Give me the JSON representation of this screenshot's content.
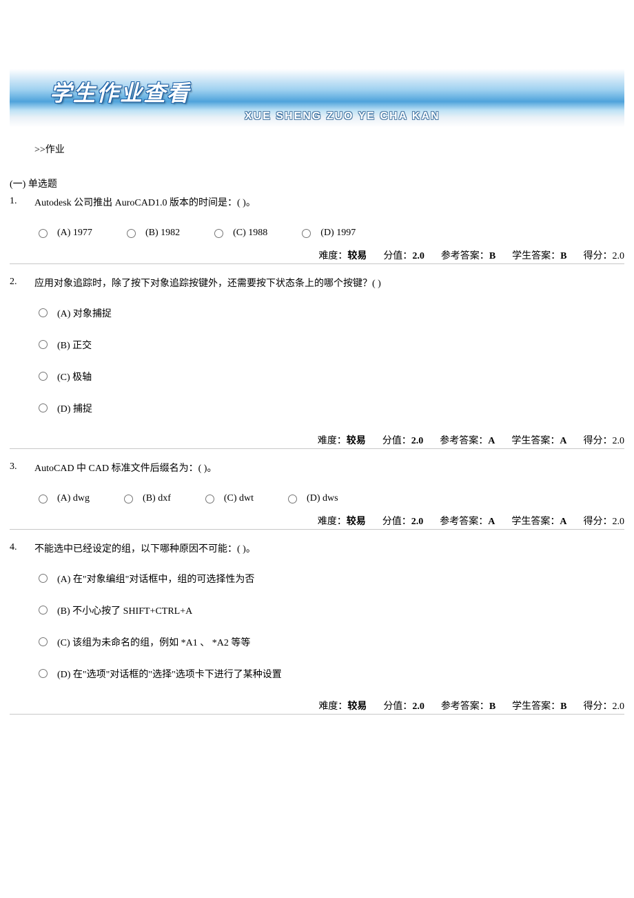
{
  "banner": {
    "title_cn": "学生作业查看",
    "title_en": "XUE SHENG ZUO YE CHA KAN"
  },
  "breadcrumb": ">>作业",
  "section_label": "(一) 单选题",
  "labels": {
    "difficulty": "难度：",
    "score_value": "分值：",
    "ref_answer": "参考答案：",
    "student_answer": "学生答案：",
    "got_score": "得分："
  },
  "questions": [
    {
      "num": "1.",
      "text": "Autodesk 公司推出 AuroCAD1.0 版本的时间是：( )。",
      "layout": "inline",
      "options": [
        {
          "label": "(A) 1977"
        },
        {
          "label": "(B) 1982"
        },
        {
          "label": "(C) 1988"
        },
        {
          "label": "(D) 1997"
        }
      ],
      "meta": {
        "difficulty": "较易",
        "score_value": "2.0",
        "ref_answer": "B",
        "student_answer": "B",
        "got_score": "2.0"
      }
    },
    {
      "num": "2.",
      "text": "应用对象追踪时，除了按下对象追踪按键外，还需要按下状态条上的哪个按键？( )",
      "layout": "stack",
      "options": [
        {
          "label": "(A) 对象捕捉"
        },
        {
          "label": "(B) 正交"
        },
        {
          "label": "(C) 极轴"
        },
        {
          "label": "(D) 捕捉"
        }
      ],
      "meta": {
        "difficulty": "较易",
        "score_value": "2.0",
        "ref_answer": "A",
        "student_answer": "A",
        "got_score": "2.0"
      }
    },
    {
      "num": "3.",
      "text": "AutoCAD 中 CAD 标准文件后缀名为：( )。",
      "layout": "inline",
      "options": [
        {
          "label": "(A) dwg"
        },
        {
          "label": "(B) dxf"
        },
        {
          "label": "(C) dwt"
        },
        {
          "label": "(D) dws"
        }
      ],
      "meta": {
        "difficulty": "较易",
        "score_value": "2.0",
        "ref_answer": "A",
        "student_answer": "A",
        "got_score": "2.0"
      }
    },
    {
      "num": "4.",
      "text": "不能选中已经设定的组，以下哪种原因不可能：( )。",
      "layout": "stack",
      "options": [
        {
          "label": "(A) 在\"对象编组\"对话框中，组的可选择性为否"
        },
        {
          "label": "(B) 不小心按了 SHIFT+CTRL+A"
        },
        {
          "label": "(C) 该组为未命名的组，例如 *A1 、 *A2 等等"
        },
        {
          "label": "(D) 在\"选项\"对话框的\"选择\"选项卡下进行了某种设置"
        }
      ],
      "meta": {
        "difficulty": "较易",
        "score_value": "2.0",
        "ref_answer": "B",
        "student_answer": "B",
        "got_score": "2.0"
      }
    }
  ]
}
